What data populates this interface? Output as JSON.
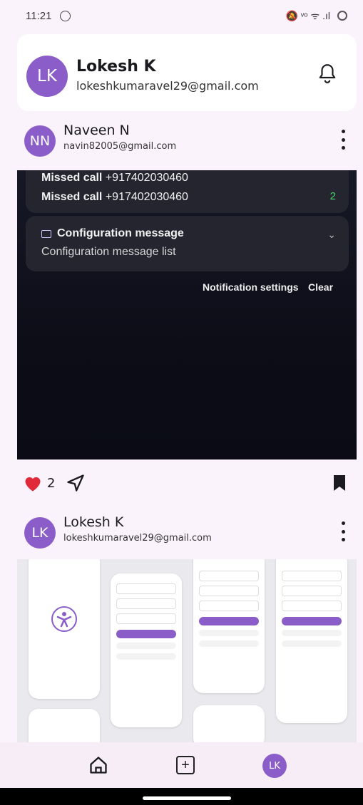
{
  "status_bar": {
    "time": "11:21",
    "right_icons": "🔕 ᵛᵒ ᯤ .ıl"
  },
  "profile": {
    "initials": "LK",
    "name": "Lokesh K",
    "email": "lokeshkumaravel29@gmail.com"
  },
  "posts": [
    {
      "initials": "NN",
      "name": "Naveen N",
      "email": "navin82005@gmail.com",
      "screenshot": {
        "notifications": [
          {
            "title": "Missed call",
            "number": "+917402030460"
          },
          {
            "title": "Missed call",
            "number": "+917402030460"
          }
        ],
        "missed_count": "2",
        "config_title": "Configuration message",
        "config_sub": "Configuration message list",
        "settings_label": "Notification settings",
        "clear_label": "Clear"
      },
      "likes": "2"
    },
    {
      "initials": "LK",
      "name": "Lokesh K",
      "email": "lokeshkumaravel29@gmail.com"
    }
  ],
  "nav": {
    "avatar_initials": "LK"
  },
  "colors": {
    "accent": "#8b5dc9",
    "heart": "#e02a3a",
    "background": "#fbf3fb"
  }
}
